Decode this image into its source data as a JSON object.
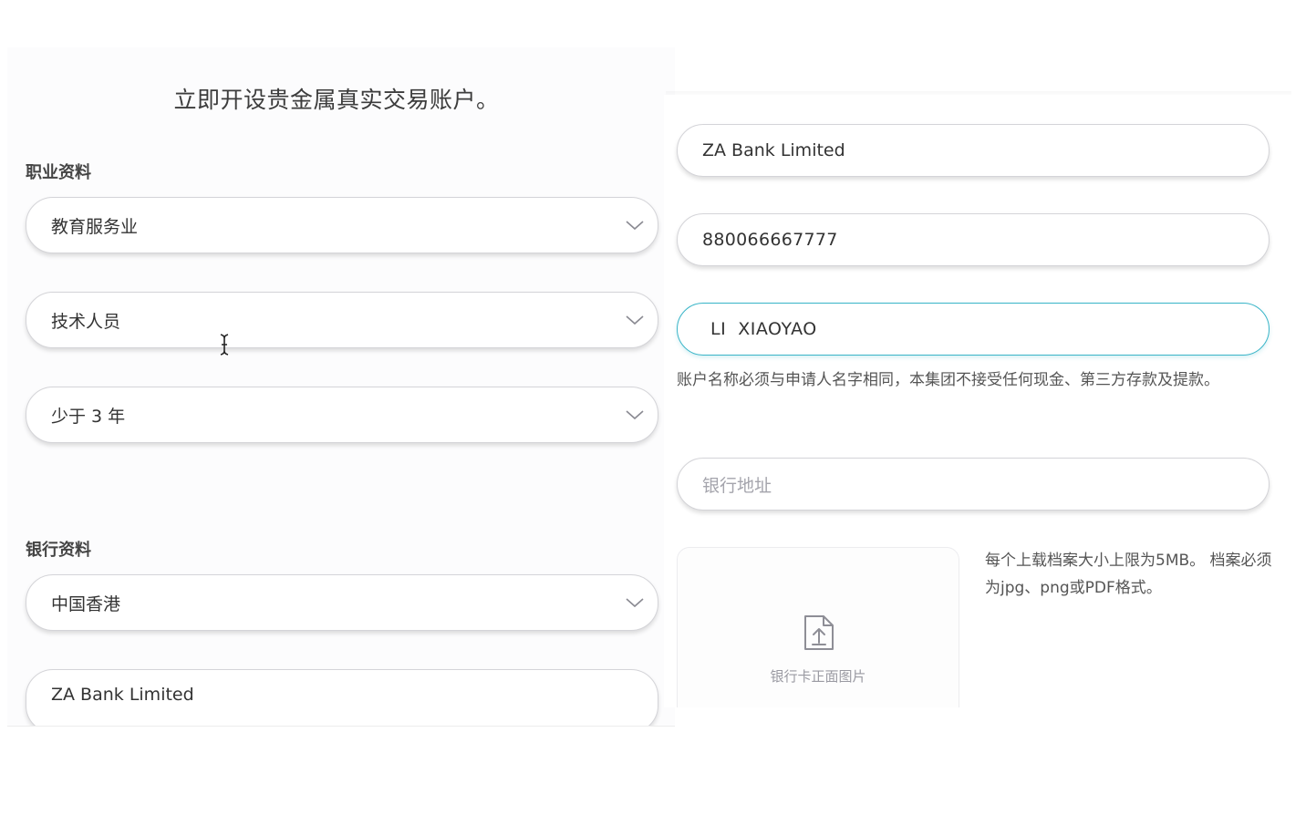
{
  "left_panel": {
    "page_title": "立即开设贵金属真实交易账户。",
    "occupation_section": {
      "title": "职业资料",
      "industry_select": {
        "value": "教育服务业",
        "icon": "chevron-down-icon"
      },
      "position_select": {
        "value": "技术人员",
        "icon": "chevron-down-icon"
      },
      "years_select": {
        "value": "少于 3 年",
        "icon": "chevron-down-icon"
      }
    },
    "bank_section": {
      "title": "银行资料",
      "region_select": {
        "value": "中国香港",
        "icon": "chevron-down-icon"
      },
      "bank_name_field": {
        "value": "ZA Bank Limited"
      }
    }
  },
  "right_panel": {
    "bank_name_field": {
      "value": "ZA Bank Limited"
    },
    "account_number_field": {
      "value": "880066667777"
    },
    "account_holder_field": {
      "value": "LI  XIAOYAO",
      "state": "focused"
    },
    "account_name_hint": "账户名称必须与申请人名字相同，本集团不接受任何现金、第三方存款及提款。",
    "bank_address_field": {
      "placeholder": "银行地址",
      "value": ""
    },
    "upload": {
      "label": "银行卡正面图片",
      "icon": "file-upload-icon",
      "hint": "每个上载档案大小上限为5MB。 档案必须为jpg、png或PDF格式。"
    }
  },
  "colors": {
    "focus_border": "#3ab5c8",
    "field_border": "#d4d4d8",
    "placeholder": "#a4a4ac",
    "text": "#333333"
  }
}
